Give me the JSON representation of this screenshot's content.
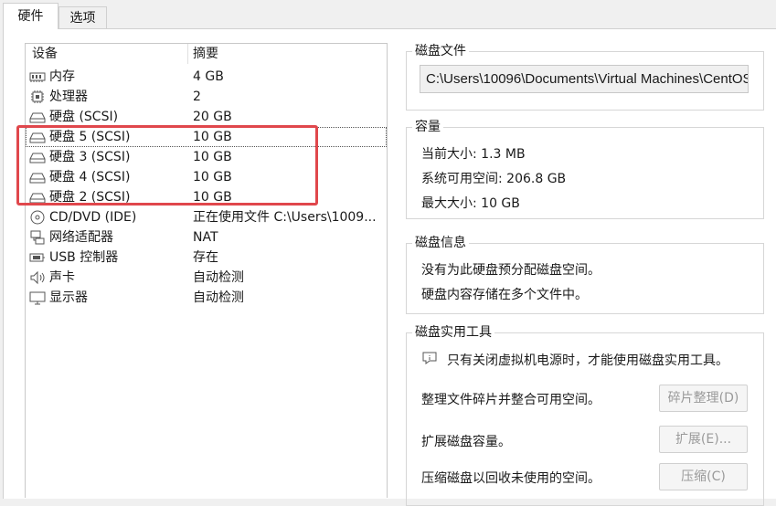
{
  "tabs": [
    "硬件",
    "选项"
  ],
  "device_list": {
    "columns": [
      "设备",
      "摘要"
    ],
    "rows": [
      {
        "icon": "memory-icon",
        "name": "内存",
        "summary": "4 GB"
      },
      {
        "icon": "processor-icon",
        "name": "处理器",
        "summary": "2"
      },
      {
        "icon": "harddisk-icon",
        "name": "硬盘 (SCSI)",
        "summary": "20 GB"
      },
      {
        "icon": "harddisk-icon",
        "name": "硬盘 5 (SCSI)",
        "summary": "10 GB"
      },
      {
        "icon": "harddisk-icon",
        "name": "硬盘 3 (SCSI)",
        "summary": "10 GB"
      },
      {
        "icon": "harddisk-icon",
        "name": "硬盘 4 (SCSI)",
        "summary": "10 GB"
      },
      {
        "icon": "harddisk-icon",
        "name": "硬盘 2 (SCSI)",
        "summary": "10 GB"
      },
      {
        "icon": "cd-dvd-icon",
        "name": "CD/DVD (IDE)",
        "summary": "正在使用文件 C:\\Users\\1009..."
      },
      {
        "icon": "network-adapter-icon",
        "name": "网络适配器",
        "summary": "NAT"
      },
      {
        "icon": "usb-controller-icon",
        "name": "USB 控制器",
        "summary": "存在"
      },
      {
        "icon": "sound-card-icon",
        "name": "声卡",
        "summary": "自动检测"
      },
      {
        "icon": "display-icon",
        "name": "显示器",
        "summary": "自动检测"
      }
    ]
  },
  "disk_file": {
    "title": "磁盘文件",
    "path": "C:\\Users\\10096\\Documents\\Virtual Machines\\CentOS"
  },
  "capacity": {
    "title": "容量",
    "current_size": "当前大小: 1.3 MB",
    "available": "系统可用空间: 206.8 GB",
    "max_size": "最大大小: 10 GB"
  },
  "disk_info": {
    "title": "磁盘信息",
    "line1": "没有为此硬盘预分配磁盘空间。",
    "line2": "硬盘内容存储在多个文件中。"
  },
  "disk_tools": {
    "title": "磁盘实用工具",
    "notice": "只有关闭虚拟机电源时，才能使用磁盘实用工具。",
    "defrag_text": "整理文件碎片并整合可用空间。",
    "defrag_button": "碎片整理(D)",
    "expand_text": "扩展磁盘容量。",
    "expand_button": "扩展(E)...",
    "compact_text": "压缩磁盘以回收未使用的空间。",
    "compact_button": "压缩(C)"
  },
  "colors": {
    "highlight_border": "#e0474c"
  }
}
